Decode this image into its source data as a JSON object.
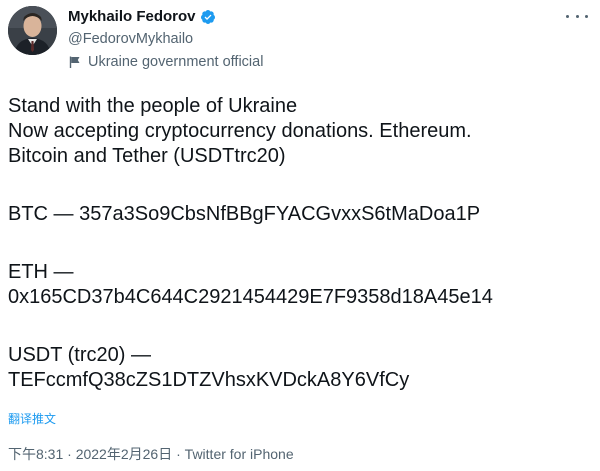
{
  "author": {
    "name": "Mykhailo Fedorov",
    "handle": "@FedorovMykhailo",
    "label": "Ukraine government official",
    "verified_color": "#1d9bf0"
  },
  "tweet": {
    "line1": "Stand with the people of Ukraine",
    "line2": "Now accepting cryptocurrency donations. Ethereum.",
    "line3": "Bitcoin and Tether (USDTtrc20)",
    "btc": "BTC — 357a3So9CbsNfBBgFYACGvxxS6tMaDoa1P",
    "eth_label": "ETH —",
    "eth_addr": "0x165CD37b4C644C2921454429E7F9358d18A45e14",
    "usdt_label": "USDT (trc20) —",
    "usdt_addr": "TEFccmfQ38cZS1DTZVhsxKVDckA8Y6VfCy"
  },
  "translate_label": "翻译推文",
  "meta": {
    "time": "下午8:31",
    "date": "2022年2月26日",
    "source": "Twitter for iPhone",
    "separator": " · "
  },
  "icons": {
    "verified": "verified-badge-icon",
    "flag": "government-flag-icon",
    "more": "more-options-icon"
  }
}
